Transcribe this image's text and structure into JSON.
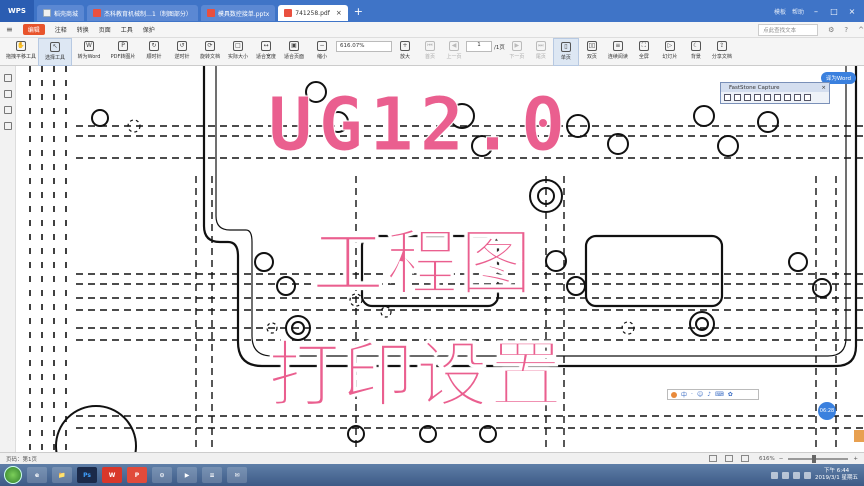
{
  "tabs": {
    "brand": "WPS",
    "items": [
      {
        "label": "稻壳商城"
      },
      {
        "label": "杰科教育机械制…1（制图部分）"
      },
      {
        "label": "模具数控接单.pptx"
      },
      {
        "label": "741258.pdf"
      }
    ],
    "add": "+",
    "right_items": [
      "模板",
      "帮助"
    ]
  },
  "menu": {
    "file": "编辑",
    "items": [
      "注释",
      "转换",
      "页面",
      "工具",
      "保护"
    ],
    "search_placeholder": "点此查找文本",
    "right_icons": [
      "⚙",
      "?",
      "^"
    ]
  },
  "toolbar": {
    "tools": [
      {
        "label": "拖拽平移工具",
        "icon": "✋"
      },
      {
        "label": "选择工具",
        "icon": "↖"
      },
      {
        "label": "转为Word",
        "icon": "W"
      },
      {
        "label": "PDF转图片",
        "icon": "P"
      },
      {
        "label": "顺时针",
        "icon": "↻"
      },
      {
        "label": "逆时针",
        "icon": "↺"
      },
      {
        "label": "旋转文档",
        "icon": "⟳"
      },
      {
        "label": "实际大小",
        "icon": "□"
      },
      {
        "label": "适合宽度",
        "icon": "↔"
      },
      {
        "label": "适合页面",
        "icon": "▣"
      },
      {
        "label": "缩小",
        "icon": "−"
      }
    ],
    "zoom_value": "616.07%",
    "zoom_in": "放大",
    "nav_tools": [
      {
        "label": "首页",
        "icon": "⏮"
      },
      {
        "label": "上一页",
        "icon": "◀"
      }
    ],
    "page_value": "1",
    "page_total": "/1页",
    "nav_tools2": [
      {
        "label": "下一页",
        "icon": "▶"
      },
      {
        "label": "尾页",
        "icon": "⏭"
      }
    ],
    "view_tools": [
      {
        "label": "单页",
        "icon": "▯"
      },
      {
        "label": "双页",
        "icon": "▯▯"
      },
      {
        "label": "连续阅读",
        "icon": "≡"
      },
      {
        "label": "全屏",
        "icon": "⛶"
      },
      {
        "label": "幻灯片",
        "icon": "▷"
      },
      {
        "label": "背景",
        "icon": "☾"
      },
      {
        "label": "分享文档",
        "icon": "⇪"
      }
    ]
  },
  "overlay": {
    "line1": "UG12.0",
    "line2": "工程图",
    "line3": "打印设置"
  },
  "widgets": {
    "translate": "译为Word",
    "faststone_title": "FastStone Capture",
    "ime_label": "中",
    "time_bubble": "06:28"
  },
  "statusbar": {
    "page_info": "页码：第1页",
    "zoom_pct": "616%"
  },
  "taskbar": {
    "apps": [
      "e",
      "📁",
      "Ps",
      "W",
      "P",
      "⊙",
      "▶",
      "≡",
      "✉"
    ],
    "clock_time": "下午 6:44",
    "clock_date": "2019/3/1 星期五"
  },
  "colors": {
    "tabbar": "#3f74c7",
    "overlay_pink": "#ea5f8f",
    "file_button": "#e8542c"
  }
}
